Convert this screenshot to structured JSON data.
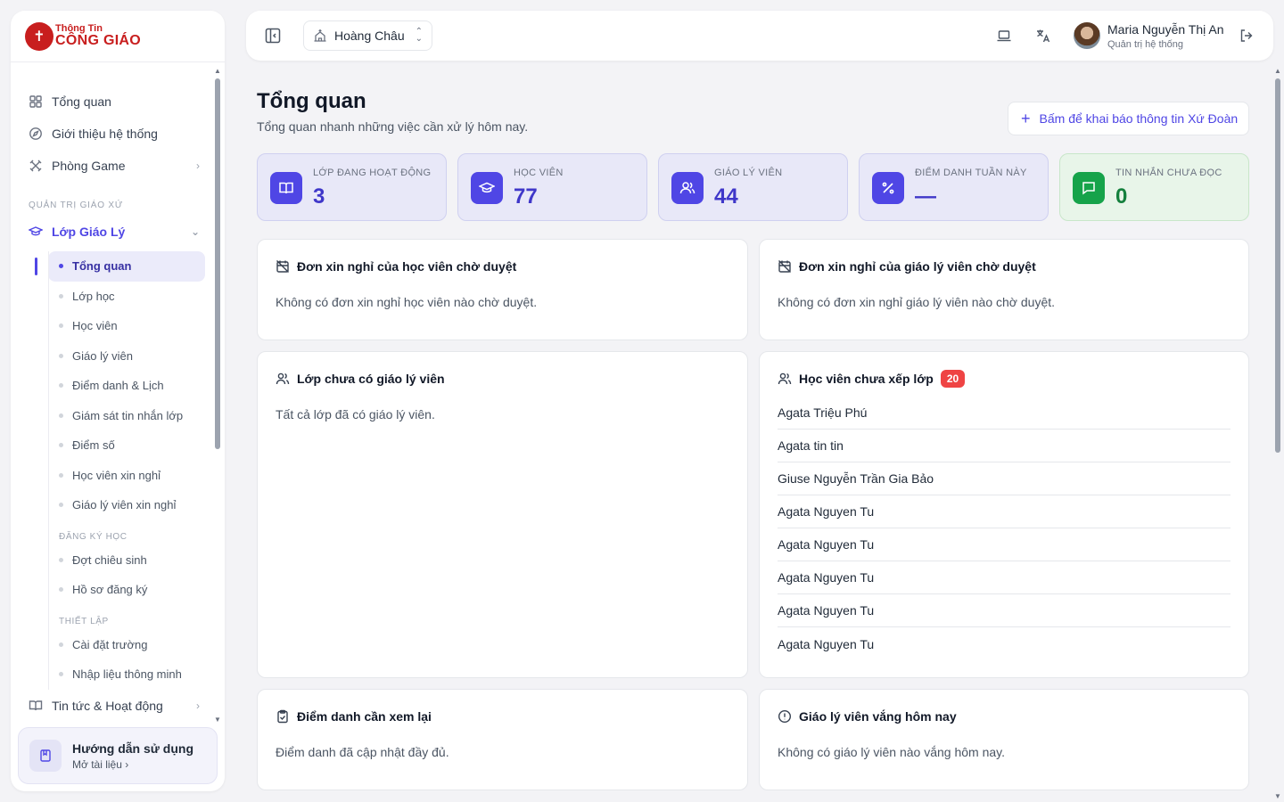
{
  "brand": {
    "line1": "Thông Tin",
    "line2": "CÔNG GIÁO"
  },
  "sidebar": {
    "top_items": [
      {
        "label": "Tổng quan",
        "icon": "grid-icon"
      },
      {
        "label": "Giới thiệu hệ thống",
        "icon": "compass-icon"
      },
      {
        "label": "Phòng Game",
        "icon": "game-icon"
      }
    ],
    "section_label": "QUẢN TRỊ GIÁO XỨ",
    "group": {
      "label": "Lớp Giáo Lý",
      "icon": "graduation-cap-icon"
    },
    "sub_items": [
      "Tổng quan",
      "Lớp học",
      "Học viên",
      "Giáo lý viên",
      "Điểm danh & Lịch",
      "Giám sát tin nhắn lớp",
      "Điểm số",
      "Học viên xin nghỉ",
      "Giáo lý viên xin nghỉ"
    ],
    "sub_label_enroll": "ĐĂNG KÝ HỌC",
    "enroll_items": [
      "Đợt chiêu sinh",
      "Hồ sơ đăng ký"
    ],
    "sub_label_setup": "THIẾT LẬP",
    "setup_items": [
      "Cài đặt trường",
      "Nhập liệu thông minh"
    ],
    "bottom_item": {
      "label": "Tin tức & Hoạt động",
      "icon": "book-icon"
    },
    "guide": {
      "title": "Hướng dẫn sử dụng",
      "link": "Mở tài liệu"
    }
  },
  "header": {
    "parish": "Hoàng Châu",
    "user_name": "Maria Nguyễn Thị An",
    "user_role": "Quản trị hệ thống"
  },
  "page": {
    "title": "Tổng quan",
    "subtitle": "Tổng quan nhanh những việc cần xử lý hôm nay.",
    "cta": "Bấm để khai báo thông tin Xứ Đoàn"
  },
  "stats": [
    {
      "label": "LỚP ĐANG HOẠT ĐỘNG",
      "value": "3"
    },
    {
      "label": "HỌC VIÊN",
      "value": "77"
    },
    {
      "label": "GIÁO LÝ VIÊN",
      "value": "44"
    },
    {
      "label": "ĐIỂM DANH TUẦN NÀY",
      "value": "—"
    },
    {
      "label": "TIN NHẮN CHƯA ĐỌC",
      "value": "0"
    }
  ],
  "cards": {
    "student_leave": {
      "title": "Đơn xin nghỉ của học viên chờ duyệt",
      "body": "Không có đơn xin nghỉ học viên nào chờ duyệt."
    },
    "teacher_leave": {
      "title": "Đơn xin nghỉ của giáo lý viên chờ duyệt",
      "body": "Không có đơn xin nghỉ giáo lý viên nào chờ duyệt."
    },
    "no_teacher": {
      "title": "Lớp chưa có giáo lý viên",
      "body": "Tất cả lớp đã có giáo lý viên."
    },
    "unassigned": {
      "title": "Học viên chưa xếp lớp",
      "badge": "20",
      "students": [
        "Agata Triệu Phú",
        "Agata tin tin",
        "Giuse Nguyễn Trần Gia Bảo",
        "Agata Nguyen Tu",
        "Agata Nguyen Tu",
        "Agata Nguyen Tu",
        "Agata Nguyen Tu",
        "Agata Nguyen Tu"
      ]
    },
    "attendance": {
      "title": "Điểm danh cần xem lại",
      "body": "Điểm danh đã cập nhật đầy đủ."
    },
    "absent": {
      "title": "Giáo lý viên vắng hôm nay",
      "body": "Không có giáo lý viên nào vắng hôm nay."
    }
  }
}
